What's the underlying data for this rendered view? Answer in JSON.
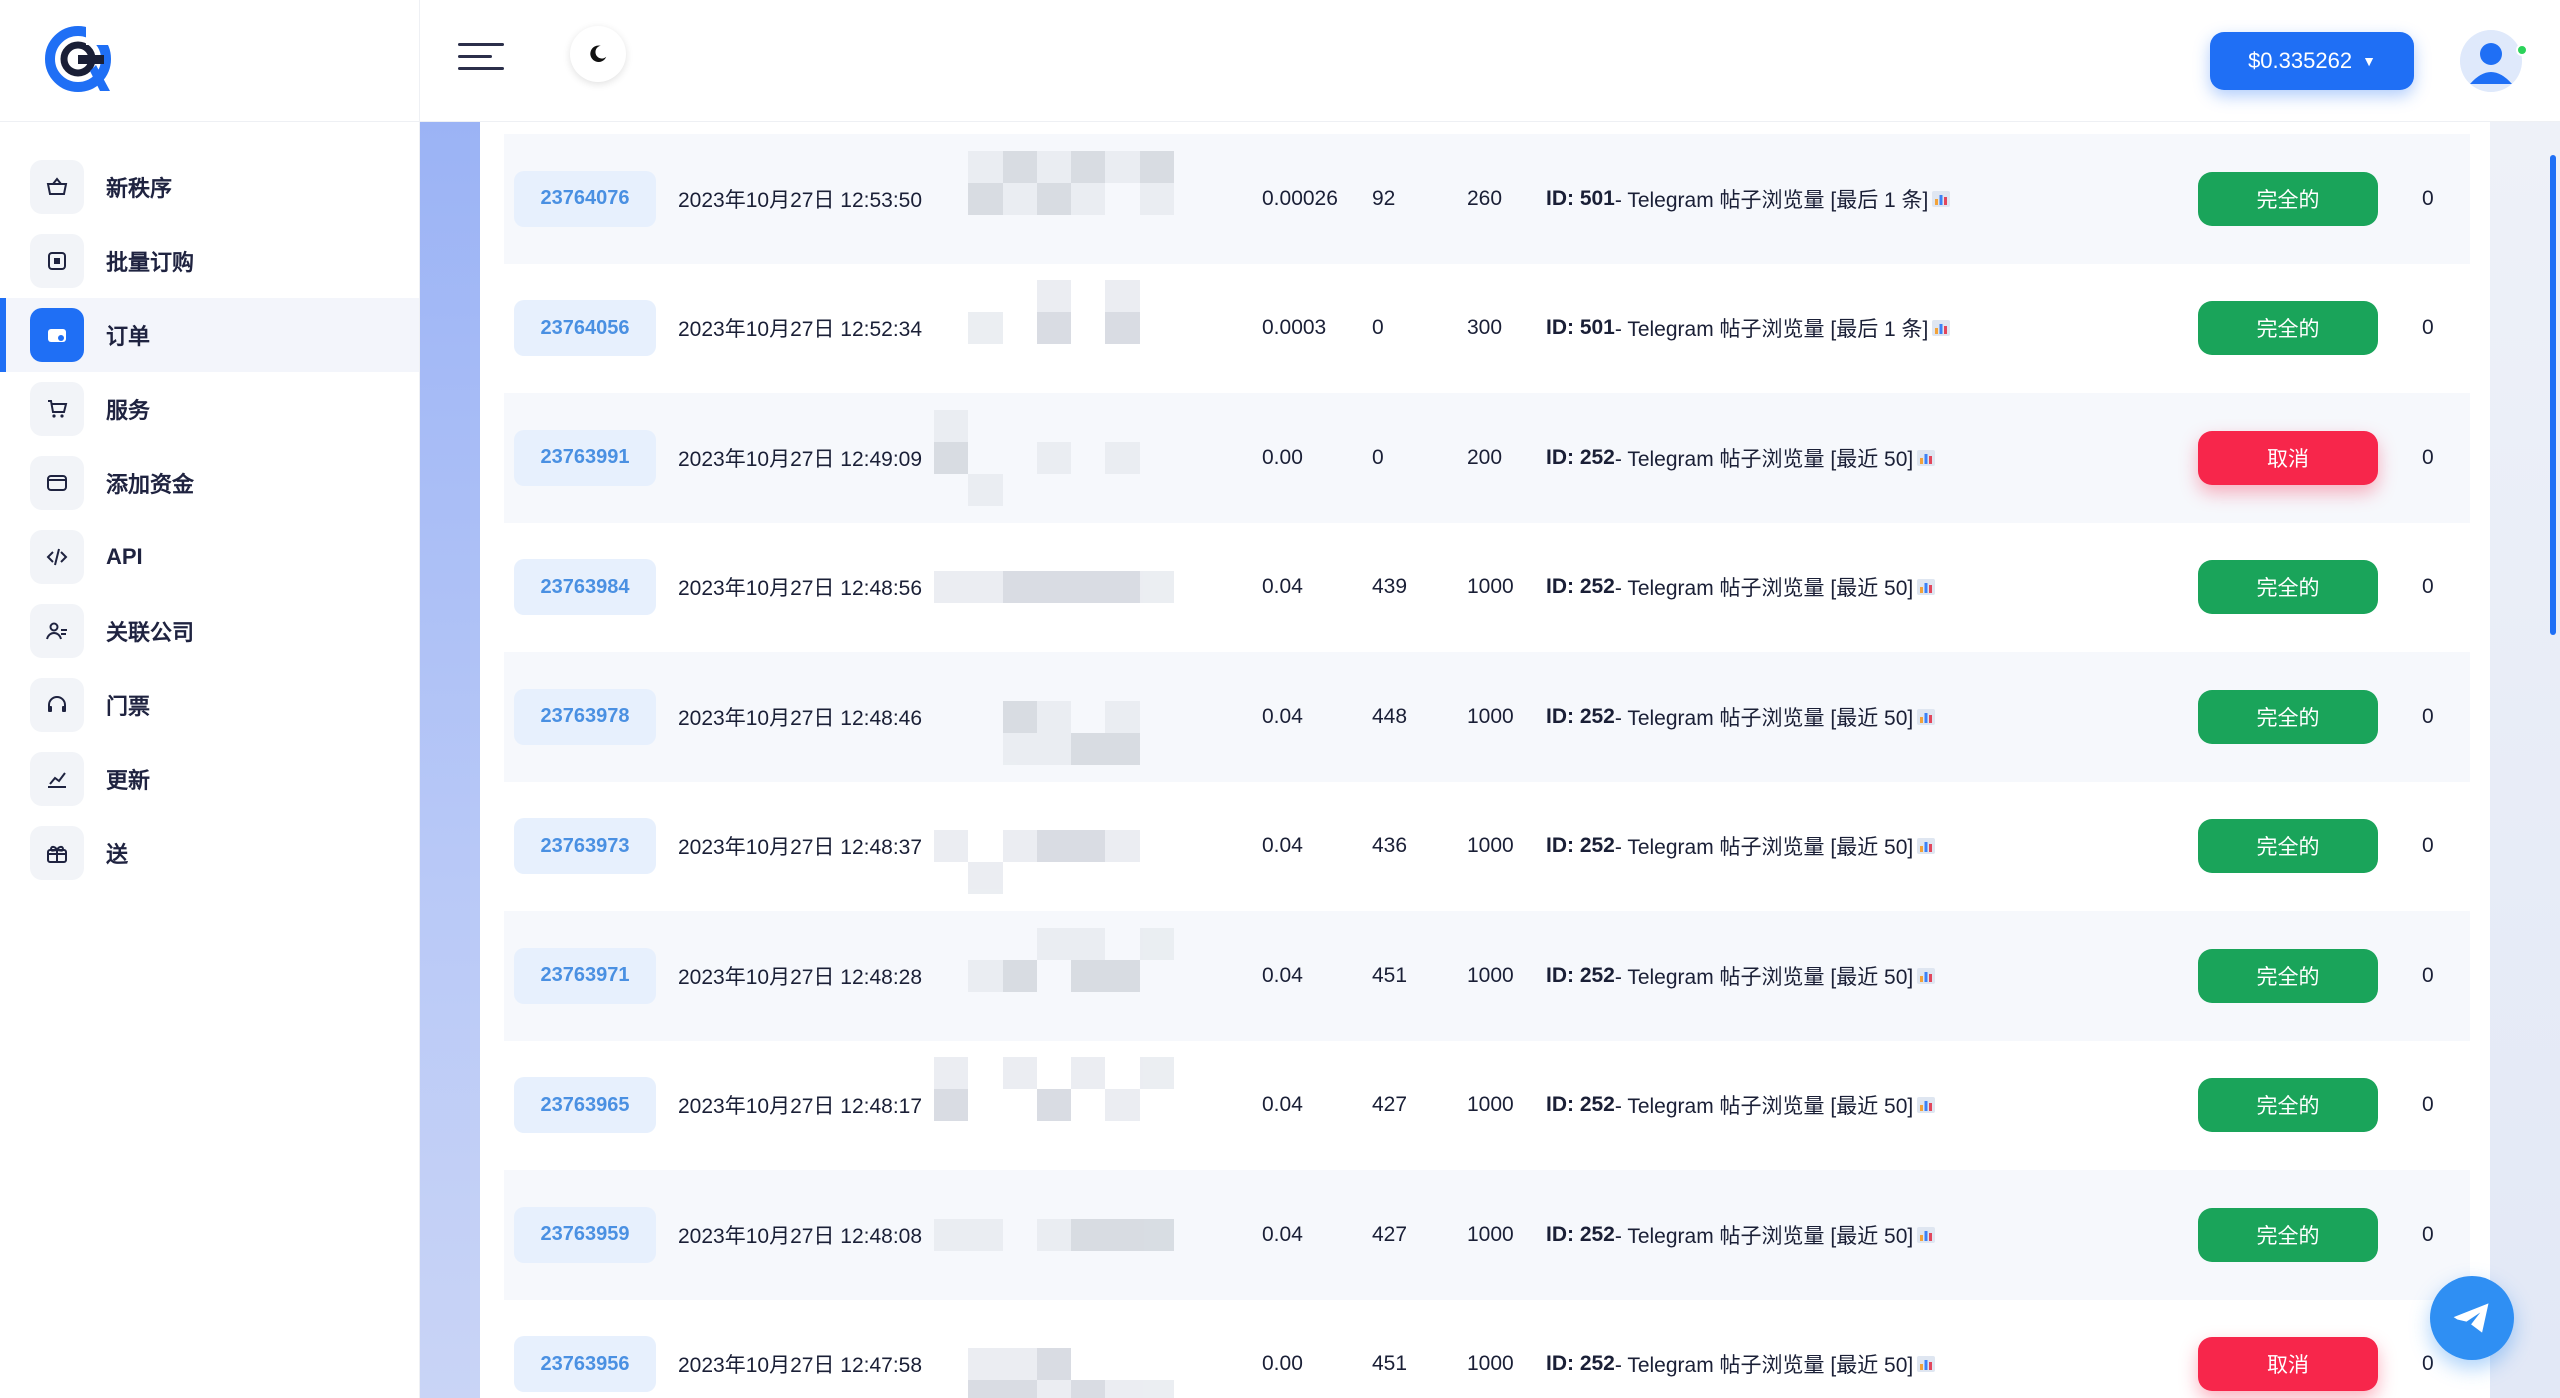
{
  "sidebar": {
    "items": [
      {
        "label": "新秩序",
        "icon": "basket-icon"
      },
      {
        "label": "批量订购",
        "icon": "box-icon"
      },
      {
        "label": "订单",
        "icon": "orders-icon",
        "active": true
      },
      {
        "label": "服务",
        "icon": "cart-icon"
      },
      {
        "label": "添加资金",
        "icon": "wallet-icon"
      },
      {
        "label": "API",
        "icon": "code-icon"
      },
      {
        "label": "关联公司",
        "icon": "users-icon"
      },
      {
        "label": "门票",
        "icon": "headset-icon"
      },
      {
        "label": "更新",
        "icon": "chart-icon"
      },
      {
        "label": "送",
        "icon": "gift-icon"
      }
    ]
  },
  "topbar": {
    "balance": "$0.335262"
  },
  "colors": {
    "accent": "#1f6ff5",
    "completed": "#1aa45a",
    "canceled": "#f7264b",
    "id_text": "#4a90e2"
  },
  "orders": [
    {
      "id": "23764076",
      "date": "2023年10月27日 12:53:50",
      "charge": "0.00026",
      "start": "92",
      "quantity": "260",
      "service_id": "ID: 501",
      "service_name": " - Telegram 帖子浏览量 [最后 1 条]",
      "status": "完全的",
      "status_type": "done",
      "remains": "0"
    },
    {
      "id": "23764056",
      "date": "2023年10月27日 12:52:34",
      "charge": "0.0003",
      "start": "0",
      "quantity": "300",
      "service_id": "ID: 501",
      "service_name": " - Telegram 帖子浏览量 [最后 1 条]",
      "status": "完全的",
      "status_type": "done",
      "remains": "0"
    },
    {
      "id": "23763991",
      "date": "2023年10月27日 12:49:09",
      "charge": "0.00",
      "start": "0",
      "quantity": "200",
      "service_id": "ID: 252",
      "service_name": " - Telegram 帖子浏览量 [最近 50]",
      "status": "取消",
      "status_type": "cancel",
      "remains": "0"
    },
    {
      "id": "23763984",
      "date": "2023年10月27日 12:48:56",
      "charge": "0.04",
      "start": "439",
      "quantity": "1000",
      "service_id": "ID: 252",
      "service_name": " - Telegram 帖子浏览量 [最近 50]",
      "status": "完全的",
      "status_type": "done",
      "remains": "0"
    },
    {
      "id": "23763978",
      "date": "2023年10月27日 12:48:46",
      "charge": "0.04",
      "start": "448",
      "quantity": "1000",
      "service_id": "ID: 252",
      "service_name": " - Telegram 帖子浏览量 [最近 50]",
      "status": "完全的",
      "status_type": "done",
      "remains": "0"
    },
    {
      "id": "23763973",
      "date": "2023年10月27日 12:48:37",
      "charge": "0.04",
      "start": "436",
      "quantity": "1000",
      "service_id": "ID: 252",
      "service_name": " - Telegram 帖子浏览量 [最近 50]",
      "status": "完全的",
      "status_type": "done",
      "remains": "0"
    },
    {
      "id": "23763971",
      "date": "2023年10月27日 12:48:28",
      "charge": "0.04",
      "start": "451",
      "quantity": "1000",
      "service_id": "ID: 252",
      "service_name": " - Telegram 帖子浏览量 [最近 50]",
      "status": "完全的",
      "status_type": "done",
      "remains": "0"
    },
    {
      "id": "23763965",
      "date": "2023年10月27日 12:48:17",
      "charge": "0.04",
      "start": "427",
      "quantity": "1000",
      "service_id": "ID: 252",
      "service_name": " - Telegram 帖子浏览量 [最近 50]",
      "status": "完全的",
      "status_type": "done",
      "remains": "0"
    },
    {
      "id": "23763959",
      "date": "2023年10月27日 12:48:08",
      "charge": "0.04",
      "start": "427",
      "quantity": "1000",
      "service_id": "ID: 252",
      "service_name": " - Telegram 帖子浏览量 [最近 50]",
      "status": "完全的",
      "status_type": "done",
      "remains": "0"
    },
    {
      "id": "23763956",
      "date": "2023年10月27日 12:47:58",
      "charge": "0.00",
      "start": "451",
      "quantity": "1000",
      "service_id": "ID: 252",
      "service_name": " - Telegram 帖子浏览量 [最近 50]",
      "status": "取消",
      "status_type": "cancel",
      "remains": "0"
    }
  ]
}
